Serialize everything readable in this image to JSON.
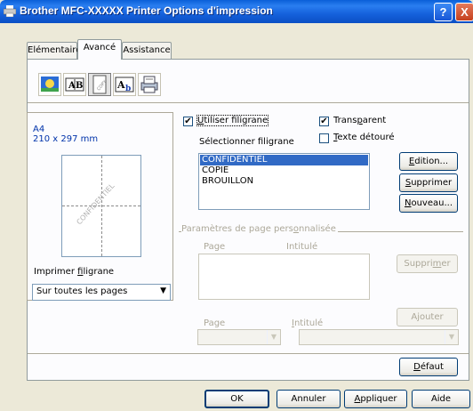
{
  "window": {
    "title": "Brother MFC-XXXXX Printer Options d'impression",
    "help_label": "?",
    "close_label": "X"
  },
  "tabs": [
    {
      "label": "Elémentaire"
    },
    {
      "label": "Avancé"
    },
    {
      "label": "Assistance"
    }
  ],
  "toolbar": {
    "icons": [
      "colour-icon",
      "scaling-icon",
      "watermark-icon",
      "header-footer-icon",
      "device-options-icon"
    ],
    "selected": "watermark-icon"
  },
  "preview": {
    "paper_name": "A4",
    "paper_size": "210 x 297 mm",
    "watermark_text": "CONFIDENTIEL"
  },
  "print_watermark": {
    "label": "Imprimer filigrane",
    "value": "Sur toutes les pages"
  },
  "watermark": {
    "use_label": "Utiliser filigrane",
    "use_checked": true,
    "select_label": "Sélectionner filigrane",
    "items": [
      "CONFIDENTIEL",
      "COPIE",
      "BROUILLON"
    ],
    "selected_index": 0,
    "transparent_label": "Transparent",
    "transparent_checked": true,
    "outline_label": "Texte détouré",
    "outline_checked": false,
    "edit_label": "Edition...",
    "delete_label": "Supprimer",
    "new_label": "Nouveau..."
  },
  "custom_page": {
    "group_label": "Paramètres de page personnalisée",
    "col_page": "Page",
    "col_title": "Intitulé",
    "delete_label": "Supprimer",
    "add_label": "Ajouter",
    "page_label": "Page",
    "title_label": "Intitulé"
  },
  "default_label": "Défaut",
  "footer": {
    "ok": "OK",
    "cancel": "Annuler",
    "apply": "Appliquer",
    "help": "Aide"
  },
  "colors": {
    "titlebar": "#0b4fc4",
    "selection": "#316ac5",
    "dialog_bg": "#ece9d8"
  }
}
